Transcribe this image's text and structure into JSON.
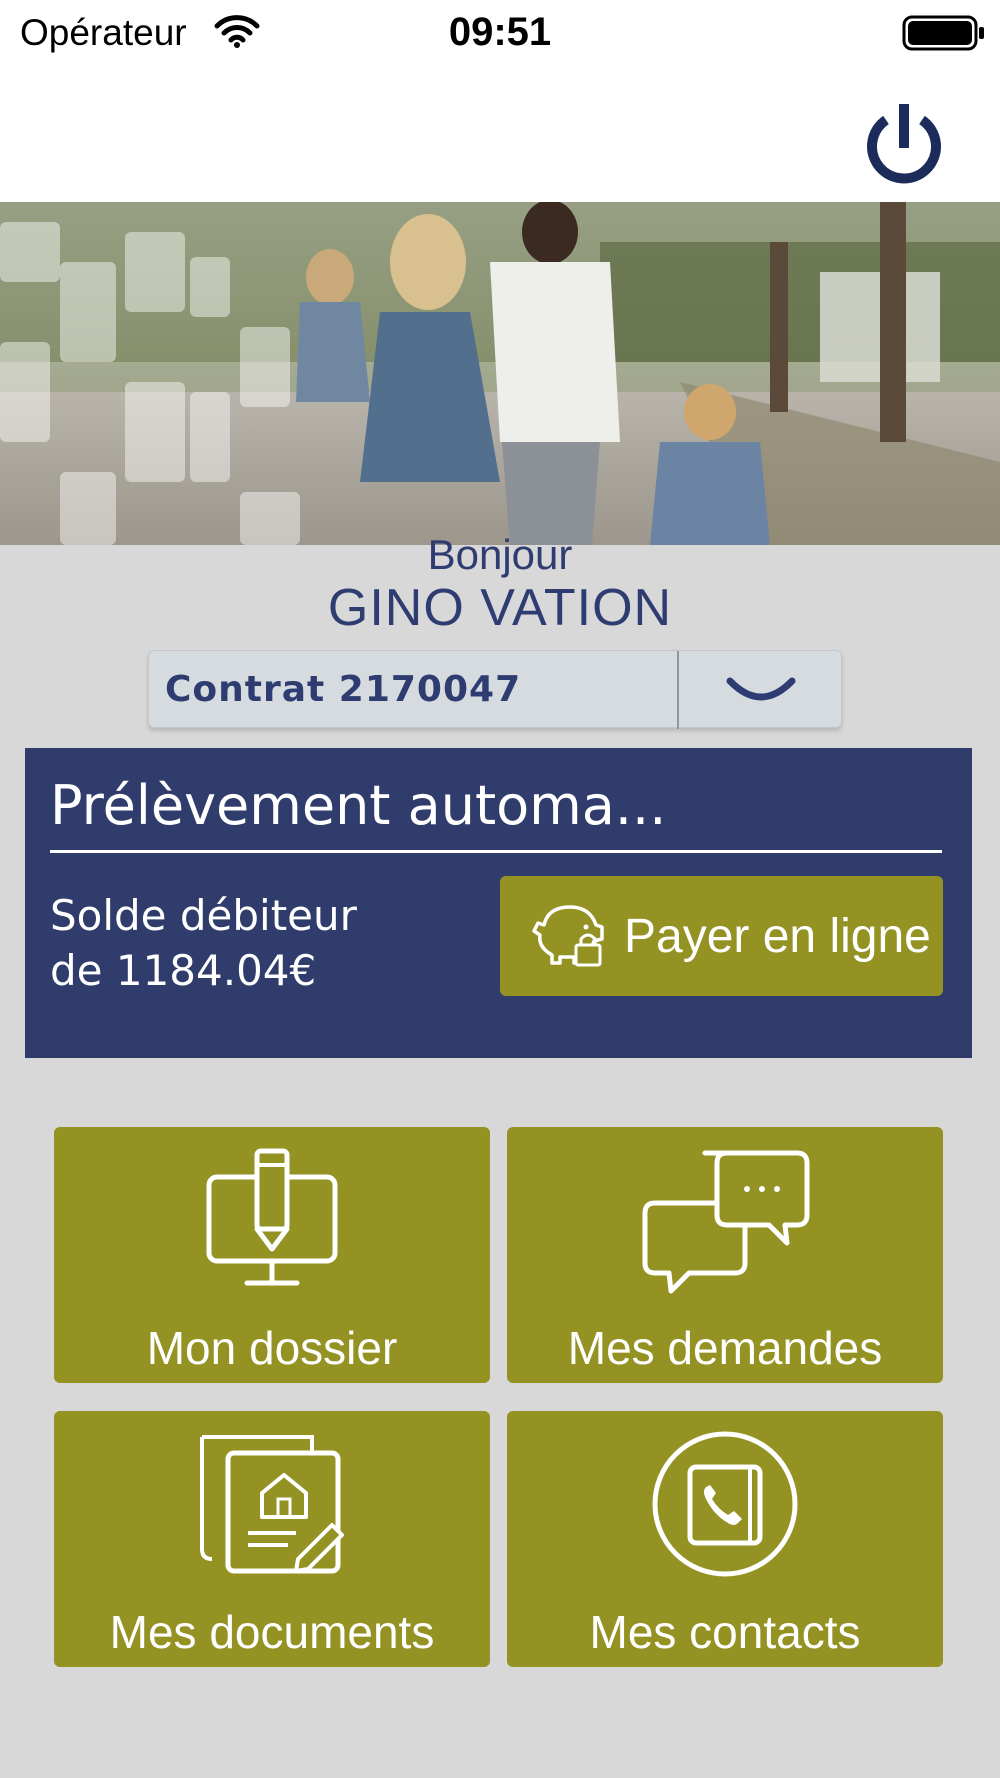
{
  "status_bar": {
    "carrier": "Opérateur",
    "time": "09:51",
    "icons": [
      "wifi-icon",
      "battery-icon"
    ]
  },
  "header": {
    "power_icon": "power-icon"
  },
  "greeting": {
    "hello": "Bonjour",
    "name": "GINO VATION"
  },
  "contract_select": {
    "selected": "Contrat 2170047",
    "icon": "chevron-down-icon"
  },
  "payment_card": {
    "title": "Prélèvement automa...",
    "balance_line1": "Solde débiteur",
    "balance_line2": "de 1184.04€",
    "pay_button": "Payer en ligne",
    "pay_icon": "piggy-bank-lock-icon"
  },
  "tiles": [
    {
      "label": "Mon dossier",
      "icon": "computer-pen-icon"
    },
    {
      "label": "Mes demandes",
      "icon": "chat-bubbles-icon"
    },
    {
      "label": "Mes documents",
      "icon": "documents-house-icon"
    },
    {
      "label": "Mes contacts",
      "icon": "phone-book-icon"
    }
  ],
  "colors": {
    "navy": "#303c6c",
    "olive": "#939222",
    "page_background": "#d8d8d8",
    "title_text": "#2e3c72"
  }
}
